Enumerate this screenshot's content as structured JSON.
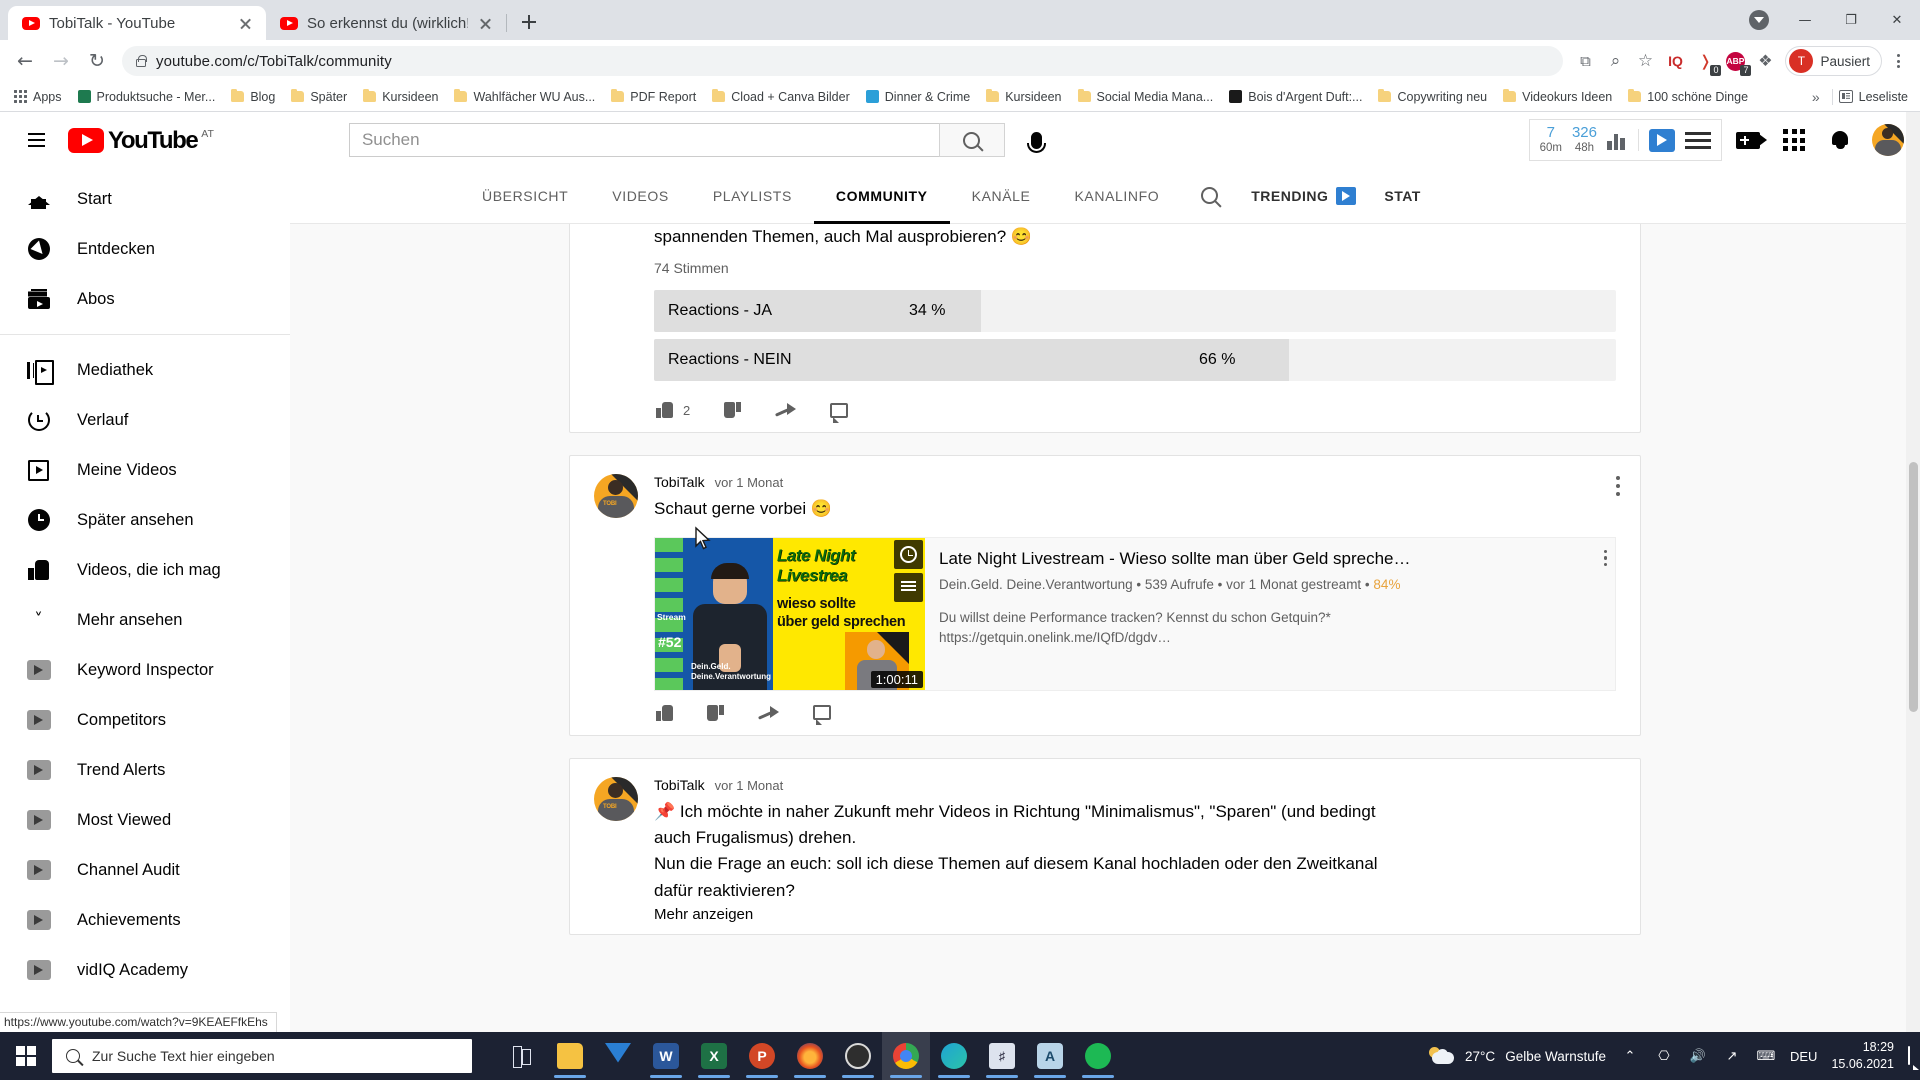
{
  "browser": {
    "tabs": [
      {
        "title": "TobiTalk - YouTube",
        "active": true,
        "favicon": "youtube-icon"
      },
      {
        "title": "So erkennst du (wirklich!) gute D",
        "active": false,
        "favicon": "youtube-icon"
      }
    ],
    "new_tab_label": "+",
    "window_controls": {
      "update": "update-icon",
      "minimize": "—",
      "maximize": "❐",
      "close": "✕"
    },
    "nav": {
      "back": "←",
      "forward": "→",
      "reload": "↻"
    },
    "omnibox": {
      "url": "youtube.com/c/TobiTalk/community",
      "lock": "lock-icon"
    },
    "toolbar_icons": [
      {
        "name": "install-icon",
        "glyph": "⧉"
      },
      {
        "name": "zoom-search-icon",
        "glyph": "⌕"
      },
      {
        "name": "star-icon",
        "glyph": "☆"
      },
      {
        "name": "vidiq-iq-icon",
        "label": "IQ"
      },
      {
        "name": "adblock-icon",
        "label": "ABP",
        "badge": "7"
      },
      {
        "name": "pocket-icon",
        "badge": "0"
      },
      {
        "name": "extensions-puzzle-icon",
        "glyph": "❖"
      }
    ],
    "profile": {
      "initial": "T",
      "label": "Pausiert"
    },
    "menu": "chrome-menu-icon",
    "bookmarks": [
      {
        "label": "Apps",
        "icon": "apps-grid-icon"
      },
      {
        "label": "Produktsuche - Mer...",
        "icon": "site-icon",
        "color": "#1e7a4f"
      },
      {
        "label": "Blog",
        "icon": "folder-icon"
      },
      {
        "label": "Später",
        "icon": "folder-icon"
      },
      {
        "label": "Kursideen",
        "icon": "folder-icon"
      },
      {
        "label": "Wahlfächer WU Aus...",
        "icon": "folder-icon"
      },
      {
        "label": "PDF Report",
        "icon": "folder-icon"
      },
      {
        "label": "Cload + Canva Bilder",
        "icon": "folder-icon"
      },
      {
        "label": "Dinner & Crime",
        "icon": "site-icon",
        "color": "#2b9fd8"
      },
      {
        "label": "Kursideen",
        "icon": "folder-icon"
      },
      {
        "label": "Social Media Mana...",
        "icon": "folder-icon"
      },
      {
        "label": "Bois d'Argent Duft:...",
        "icon": "site-icon",
        "color": "#1a1a1a"
      },
      {
        "label": "Copywriting neu",
        "icon": "folder-icon"
      },
      {
        "label": "Videokurs Ideen",
        "icon": "folder-icon"
      },
      {
        "label": "100 schöne Dinge",
        "icon": "folder-icon"
      }
    ],
    "bookmarks_overflow": "»",
    "reading_list": {
      "label": "Leseliste",
      "icon": "reading-list-icon"
    },
    "status_url": "https://www.youtube.com/watch?v=9KEAEFfkEhs"
  },
  "youtube": {
    "menu_icon": "hamburger-icon",
    "logo": {
      "word": "YouTube",
      "country": "AT"
    },
    "search": {
      "placeholder": "Suchen",
      "button_icon": "search-icon"
    },
    "mic_icon": "microphone-icon",
    "vidiq": {
      "stat1_value": "7",
      "stat1_label": "60m",
      "stat2_value": "326",
      "stat2_label": "48h",
      "chart_icon": "bar-chart-icon",
      "logo_icon": "vidiq-logo-icon",
      "menu_icon": "vidiq-menu-icon"
    },
    "header_icons": [
      {
        "name": "create-video-icon"
      },
      {
        "name": "apps-grid-icon"
      },
      {
        "name": "notifications-bell-icon"
      }
    ],
    "account_avatar": "account-avatar",
    "sidebar": {
      "group1": [
        {
          "label": "Start",
          "icon": "home-icon"
        },
        {
          "label": "Entdecken",
          "icon": "compass-icon"
        },
        {
          "label": "Abos",
          "icon": "subscriptions-icon"
        }
      ],
      "group2": [
        {
          "label": "Mediathek",
          "icon": "library-icon"
        },
        {
          "label": "Verlauf",
          "icon": "history-icon"
        },
        {
          "label": "Meine Videos",
          "icon": "my-videos-icon"
        },
        {
          "label": "Später ansehen",
          "icon": "watch-later-icon"
        },
        {
          "label": "Videos, die ich mag",
          "icon": "liked-videos-icon"
        },
        {
          "label": "Mehr ansehen",
          "icon": "chevron-down-icon"
        }
      ],
      "group3": [
        {
          "label": "Keyword Inspector",
          "icon": "vidiq-icon"
        },
        {
          "label": "Competitors",
          "icon": "vidiq-icon"
        },
        {
          "label": "Trend Alerts",
          "icon": "vidiq-icon"
        },
        {
          "label": "Most Viewed",
          "icon": "vidiq-icon"
        },
        {
          "label": "Channel Audit",
          "icon": "vidiq-icon"
        },
        {
          "label": "Achievements",
          "icon": "vidiq-icon"
        },
        {
          "label": "vidIQ Academy",
          "icon": "vidiq-icon"
        }
      ]
    },
    "channel_tabs": [
      {
        "label": "ÜBERSICHT",
        "active": false
      },
      {
        "label": "VIDEOS",
        "active": false
      },
      {
        "label": "PLAYLISTS",
        "active": false
      },
      {
        "label": "COMMUNITY",
        "active": true
      },
      {
        "label": "KANÄLE",
        "active": false
      },
      {
        "label": "KANALINFO",
        "active": false
      }
    ],
    "channel_search_icon": "search-icon",
    "trending": {
      "label": "TRENDING",
      "icon": "vidiq-logo-icon"
    },
    "stats_label": "STAT"
  },
  "posts": [
    {
      "text": "spannenden Themen, auch Mal ausprobieren? 😊",
      "votes": "74 Stimmen",
      "poll": [
        {
          "label": "Reactions - JA",
          "percent": "34 %",
          "value": 34
        },
        {
          "label": "Reactions - NEIN",
          "percent": "66 %",
          "value": 66
        }
      ],
      "actions": {
        "like_count": "2",
        "like": "thumbs-up-icon",
        "dislike": "thumbs-down-icon",
        "share": "share-icon",
        "comment": "comment-icon"
      }
    },
    {
      "author": "TobiTalk",
      "time": "vor 1 Monat",
      "text": "Schaut gerne vorbei 😊",
      "attachment": {
        "title": "Late Night Livestream - Wieso sollte man über Geld spreche…",
        "meta": "Dein.Geld. Deine.Verantwortung • 539 Aufrufe • vor 1 Monat gestreamt • ",
        "score": "84%",
        "desc_line1": "Du willst deine Performance tracken? Kennst du schon Getquin?*",
        "desc_line2": "https://getquin.onelink.me/IQfD/dgdv…",
        "duration": "1:00:11",
        "thumb": {
          "title_l1": "Late Night",
          "title_l2": "Livestrea",
          "title_l3": "wieso sollte",
          "title_l4": "über geld sprechen",
          "stream_label": "Stream",
          "episode": "#52",
          "brand_l1": "Dein.Geld.",
          "brand_l2": "Deine.Verantwortung",
          "inset_label": "TOB"
        },
        "watch_later_icon": "watch-later-clock-icon",
        "queue_icon": "add-to-queue-icon",
        "kebab_icon": "more-options-icon"
      },
      "actions": {
        "like": "thumbs-up-icon",
        "dislike": "thumbs-down-icon",
        "share": "share-icon",
        "comment": "comment-icon"
      },
      "kebab_icon": "more-options-icon"
    },
    {
      "author": "TobiTalk",
      "time": "vor 1 Monat",
      "text_line1": "📌 Ich möchte in naher Zukunft mehr Videos in Richtung \"Minimalismus\", \"Sparen\" (und bedingt",
      "text_line2": "auch Frugalismus) drehen.",
      "text_line3": "Nun die Frage an euch: soll ich diese Themen auf diesem Kanal hochladen oder den Zweitkanal",
      "text_line4": "dafür reaktivieren?",
      "show_more": "Mehr anzeigen"
    }
  ],
  "taskbar": {
    "start_icon": "windows-start-icon",
    "search_placeholder": "Zur Suche Text hier eingeben",
    "search_icon": "search-icon",
    "task_view_icon": "task-view-icon",
    "apps": [
      {
        "name": "file-explorer-icon",
        "color": "#f5c242",
        "glyph": ""
      },
      {
        "name": "mail-icon",
        "color": "#2a7fd4",
        "glyph": ""
      },
      {
        "name": "word-icon",
        "color": "#2b579a",
        "glyph": "W"
      },
      {
        "name": "excel-icon",
        "color": "#1e7145",
        "glyph": "X"
      },
      {
        "name": "powerpoint-icon",
        "color": "#d24726",
        "glyph": "P"
      },
      {
        "name": "firefox-icon",
        "color": "#e25b26",
        "glyph": ""
      },
      {
        "name": "opera-gx-icon",
        "color": "#3b3b3b",
        "glyph": ""
      },
      {
        "name": "chrome-icon",
        "color": "#ffffff",
        "glyph": ""
      },
      {
        "name": "edge-icon",
        "color": "#1fa3d4",
        "glyph": ""
      },
      {
        "name": "sony-vegas-icon",
        "color": "#2b2b40",
        "glyph": ""
      },
      {
        "name": "acrobat-icon",
        "color": "#b8d4e8",
        "glyph": "A"
      },
      {
        "name": "spotify-icon",
        "color": "#1db954",
        "glyph": ""
      }
    ],
    "tray": {
      "weather_temp": "27°C",
      "weather_text": "Gelbe Warnstufe",
      "weather_icon": "partly-cloudy-icon",
      "expand_icon": "⌃",
      "icons": [
        "screen-snip-icon",
        "volume-icon",
        "wifi-icon",
        "keyboard-icon"
      ],
      "language": "DEU",
      "time": "18:29",
      "date": "15.06.2021",
      "action_center_icon": "notifications-icon"
    }
  }
}
